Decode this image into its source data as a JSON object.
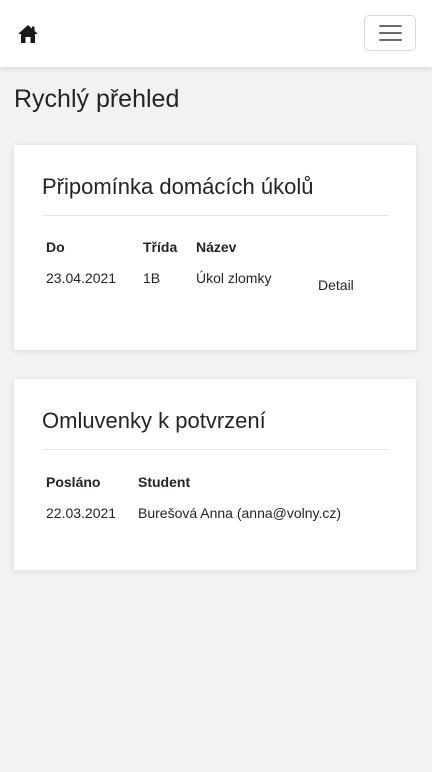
{
  "colors": {
    "page_background": "#f2f2f2",
    "navbar_background": "#ffffff",
    "card_background": "#ffffff",
    "text": "#212529",
    "home_icon": "#1a1a1a"
  },
  "navbar": {
    "home_icon": "home-icon",
    "menu_icon": "hamburger-menu-icon"
  },
  "page": {
    "title": "Rychlý přehled"
  },
  "homework_card": {
    "title": "Připomínka domácích úkolů",
    "headers": {
      "date": "Do",
      "class": "Třída",
      "name": "Název"
    },
    "rows": [
      {
        "date": "23.04.2021",
        "class": "1B",
        "name": "Úkol zlomky",
        "action": "Detail"
      }
    ]
  },
  "excuses_card": {
    "title": "Omluvenky k potvrzení",
    "headers": {
      "sent": "Posláno",
      "student": "Student"
    },
    "rows": [
      {
        "sent": "22.03.2021",
        "student": "Burešová Anna (anna@volny.cz)"
      }
    ]
  }
}
